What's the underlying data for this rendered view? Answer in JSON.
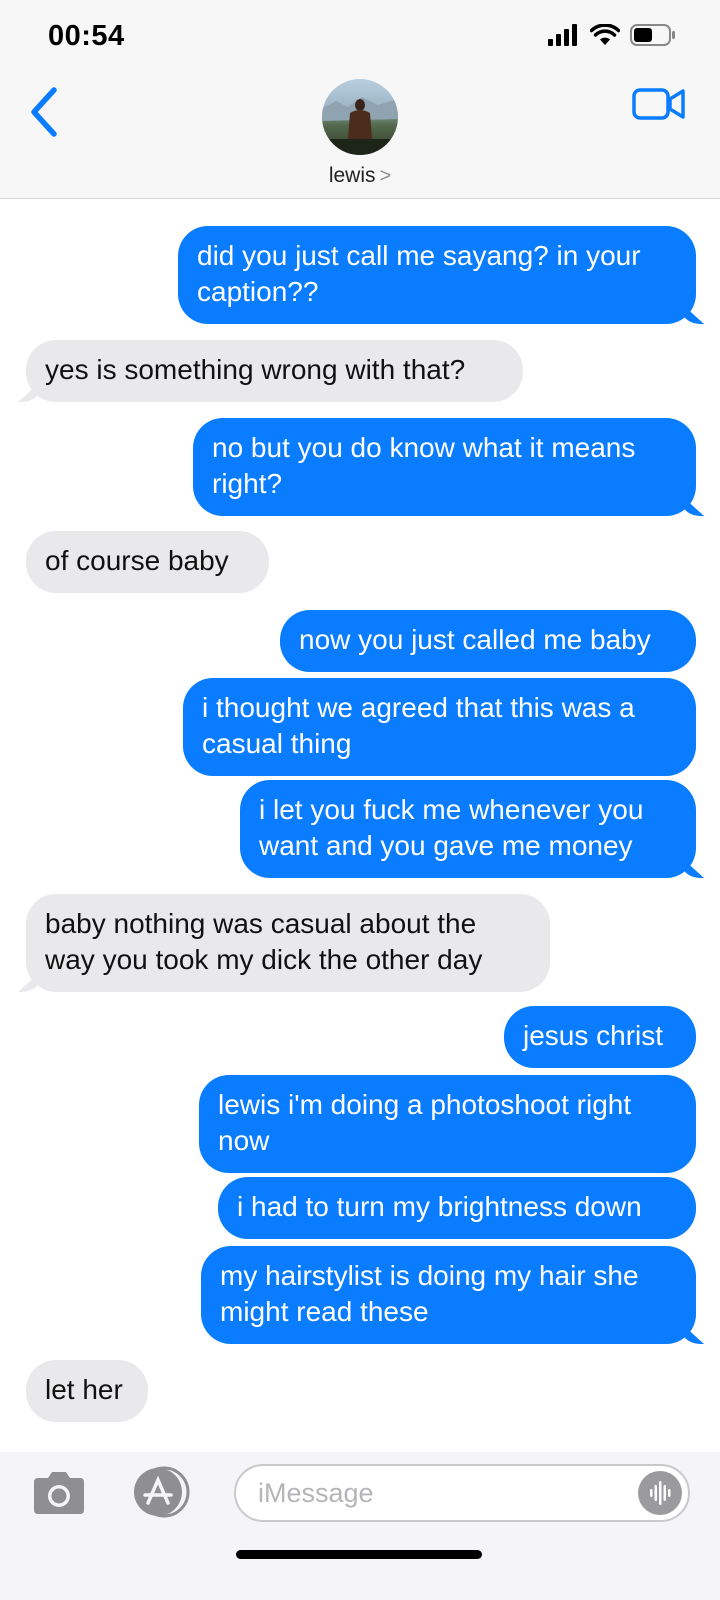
{
  "status_bar": {
    "time": "00:54",
    "icons": [
      "signal-icon",
      "wifi-icon",
      "battery-icon"
    ]
  },
  "header": {
    "back_icon": "chevron-left-icon",
    "contact_name": "lewis",
    "contact_chevron": ">",
    "video_icon": "video-camera-icon"
  },
  "colors": {
    "outgoing_bubble": "#0a7cff",
    "incoming_bubble": "#e9e9eb",
    "accent": "#0a7cff"
  },
  "messages": [
    {
      "direction": "out",
      "text": "did you just call me sayang? in your caption??"
    },
    {
      "direction": "in",
      "text": "yes is something wrong with that?"
    },
    {
      "direction": "out",
      "text": "no but you do know what it means right?"
    },
    {
      "direction": "in",
      "text": "of course baby"
    },
    {
      "direction": "out",
      "text": "now you just called me baby"
    },
    {
      "direction": "out",
      "text": "i thought we agreed that this was a casual thing"
    },
    {
      "direction": "out",
      "text": "i let you fuck me whenever you want and you gave me money"
    },
    {
      "direction": "in",
      "text": "baby nothing was casual about the way you took my dick the other day"
    },
    {
      "direction": "out",
      "text": "jesus christ"
    },
    {
      "direction": "out",
      "text": "lewis i'm doing a photoshoot right now"
    },
    {
      "direction": "out",
      "text": "i had to turn my brightness down"
    },
    {
      "direction": "out",
      "text": "my hairstylist is doing my hair she might read these"
    },
    {
      "direction": "in",
      "text": "let her"
    }
  ],
  "input_bar": {
    "camera_icon": "camera-icon",
    "apps_icon": "app-store-icon",
    "placeholder": "iMessage",
    "audio_icon": "audio-waveform-icon"
  }
}
